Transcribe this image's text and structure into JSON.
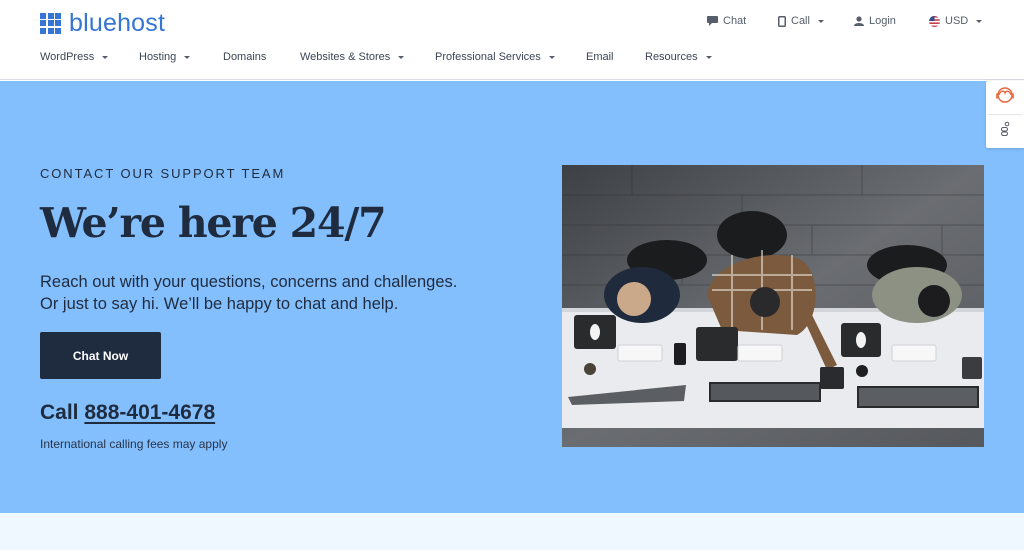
{
  "brand": {
    "name": "bluehost",
    "color": "#3575d3"
  },
  "utility_nav": {
    "chat_label": "Chat",
    "call_label": "Call",
    "login_label": "Login",
    "currency_label": "USD"
  },
  "main_nav": {
    "items": [
      {
        "label": "WordPress",
        "has_dropdown": true
      },
      {
        "label": "Hosting",
        "has_dropdown": true
      },
      {
        "label": "Domains",
        "has_dropdown": false
      },
      {
        "label": "Websites & Stores",
        "has_dropdown": true
      },
      {
        "label": "Professional Services",
        "has_dropdown": true
      },
      {
        "label": "Email",
        "has_dropdown": false
      },
      {
        "label": "Resources",
        "has_dropdown": true
      }
    ]
  },
  "hero": {
    "eyebrow": "CONTACT OUR SUPPORT TEAM",
    "title": "We’re here 24/7",
    "description_line1": "Reach out with your questions, concerns and challenges.",
    "description_line2": "Or just to say hi. We’ll be happy to chat and help.",
    "chat_button": "Chat Now",
    "call_prefix": "Call",
    "phone": "888-401-4678",
    "fees_note": "International calling fees may apply",
    "background_color": "#84bffd",
    "image_alt": "Support team working at desks, overhead view"
  },
  "side_widget": {
    "items": [
      {
        "icon": "support-headset-icon"
      },
      {
        "icon": "accessibility-icon"
      }
    ]
  },
  "colors": {
    "primary_dark": "#1f2b3e",
    "accent_orange": "#e8663d",
    "bottom_section": "#eff8ff"
  }
}
